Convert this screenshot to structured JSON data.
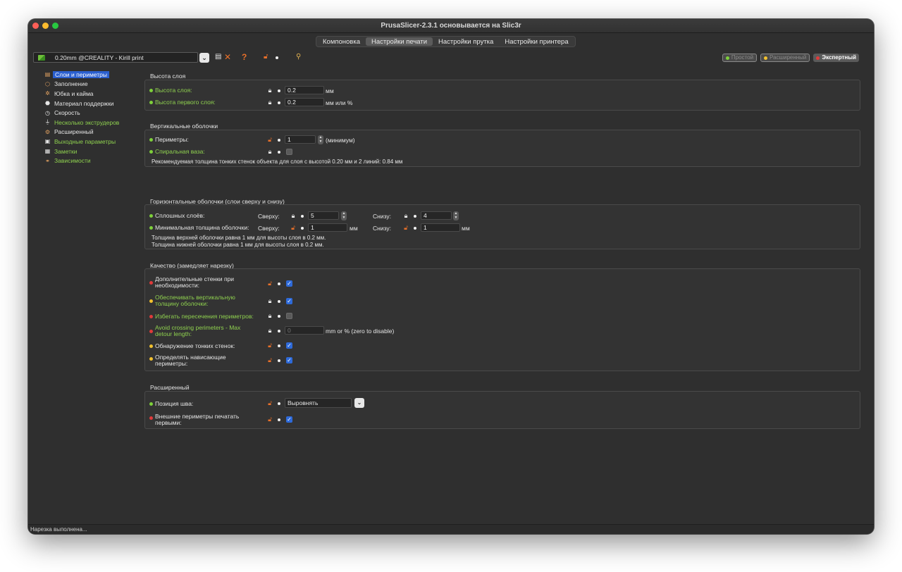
{
  "window": {
    "title": "PrusaSlicer-2.3.1 основывается на Slic3r"
  },
  "tabs": [
    {
      "label": "Компоновка",
      "active": false
    },
    {
      "label": "Настройки печати",
      "active": true
    },
    {
      "label": "Настройки прутка",
      "active": false
    },
    {
      "label": "Настройки принтера",
      "active": false
    }
  ],
  "toolbar": {
    "preset": "0.20mm @CREALITY - Kirill print",
    "dropdown_icon": "chevron-down-icon",
    "icons": [
      "save-icon",
      "delete-icon",
      "help-icon",
      "unlock-icon",
      "search-icon"
    ]
  },
  "modes": {
    "simple": "Простой",
    "advanced": "Расширенный",
    "expert": "Экспертный"
  },
  "colors": {
    "green": "#7ed03a",
    "yellow": "#f2c12e",
    "red": "#e03a3a",
    "accent": "#2a5fcf",
    "orange": "#e8702a"
  },
  "sidebar": {
    "items": [
      {
        "label": "Слои и периметры",
        "icon": "layers-icon"
      },
      {
        "label": "Заполнение",
        "icon": "infill-icon"
      },
      {
        "label": "Юбка и кайма",
        "icon": "skirt-icon"
      },
      {
        "label": "Материал поддержки",
        "icon": "support-icon"
      },
      {
        "label": "Скорость",
        "icon": "speed-icon"
      },
      {
        "label": "Несколько экструдеров",
        "icon": "extruder-icon"
      },
      {
        "label": "Расширенный",
        "icon": "advanced-icon"
      },
      {
        "label": "Выходные параметры",
        "icon": "output-icon"
      },
      {
        "label": "Заметки",
        "icon": "notes-icon"
      },
      {
        "label": "Зависимости",
        "icon": "dependencies-icon"
      }
    ]
  },
  "layer_height": {
    "title": "Высота слоя",
    "layer_label": "Высота слоя:",
    "layer_value": "0.2",
    "layer_unit": "мм",
    "first_label": "Высота первого слоя:",
    "first_value": "0.2",
    "first_unit": "мм или %"
  },
  "vertical_shells": {
    "title": "Вертикальные оболочки",
    "perimeters_label": "Периметры:",
    "perimeters_value": "1",
    "perimeters_unit": "(минимум)",
    "spiral_label": "Спиральная ваза:",
    "note": "Рекомендуемая толщина тонких стенок объекта для слоя с высотой 0.20 мм и 2 линий: 0.84 мм"
  },
  "horizontal_shells": {
    "title": "Горизонтальные оболочки (слои сверху и снизу)",
    "solid_label": "Сплошных слоёв:",
    "top_label": "Сверху:",
    "top_value": "5",
    "bottom_label": "Снизу:",
    "bottom_value": "4",
    "min_label": "Минимальная толщина оболочки:",
    "min_top_label": "Сверху:",
    "min_top_value": "1",
    "min_top_unit": "мм",
    "min_bottom_label": "Снизу:",
    "min_bottom_value": "1",
    "min_bottom_unit": "мм",
    "note1": "Толщина верхней оболочки равна 1 мм для высоты слоя в 0.2 мм.",
    "note2": "Толщина нижней оболочки равна 1 мм для высоты слоя в 0.2 мм."
  },
  "quality": {
    "title": "Качество (замедляет нарезку)",
    "extra_l1": "Дополнительные стенки при",
    "extra_l2": "необходимости:",
    "ensure_l1": "Обеспечивать вертикальную",
    "ensure_l2": "толщину оболочки:",
    "avoid_label": "Избегать пересечения периметров:",
    "detour_l1": "Avoid crossing perimeters - Max",
    "detour_l2": "detour length:",
    "detour_value": "0",
    "detour_unit": "mm or % (zero to disable)",
    "thin_label": "Обнаружение тонких стенок:",
    "overhang_l1": "Определять нависающие",
    "overhang_l2": "периметры:"
  },
  "advanced": {
    "title": "Расширенный",
    "seam_label": "Позиция шва:",
    "seam_value": "Выровнять",
    "external_l1": "Внешние периметры печатать",
    "external_l2": "первыми:"
  },
  "status": "Нарезка выполнена..."
}
